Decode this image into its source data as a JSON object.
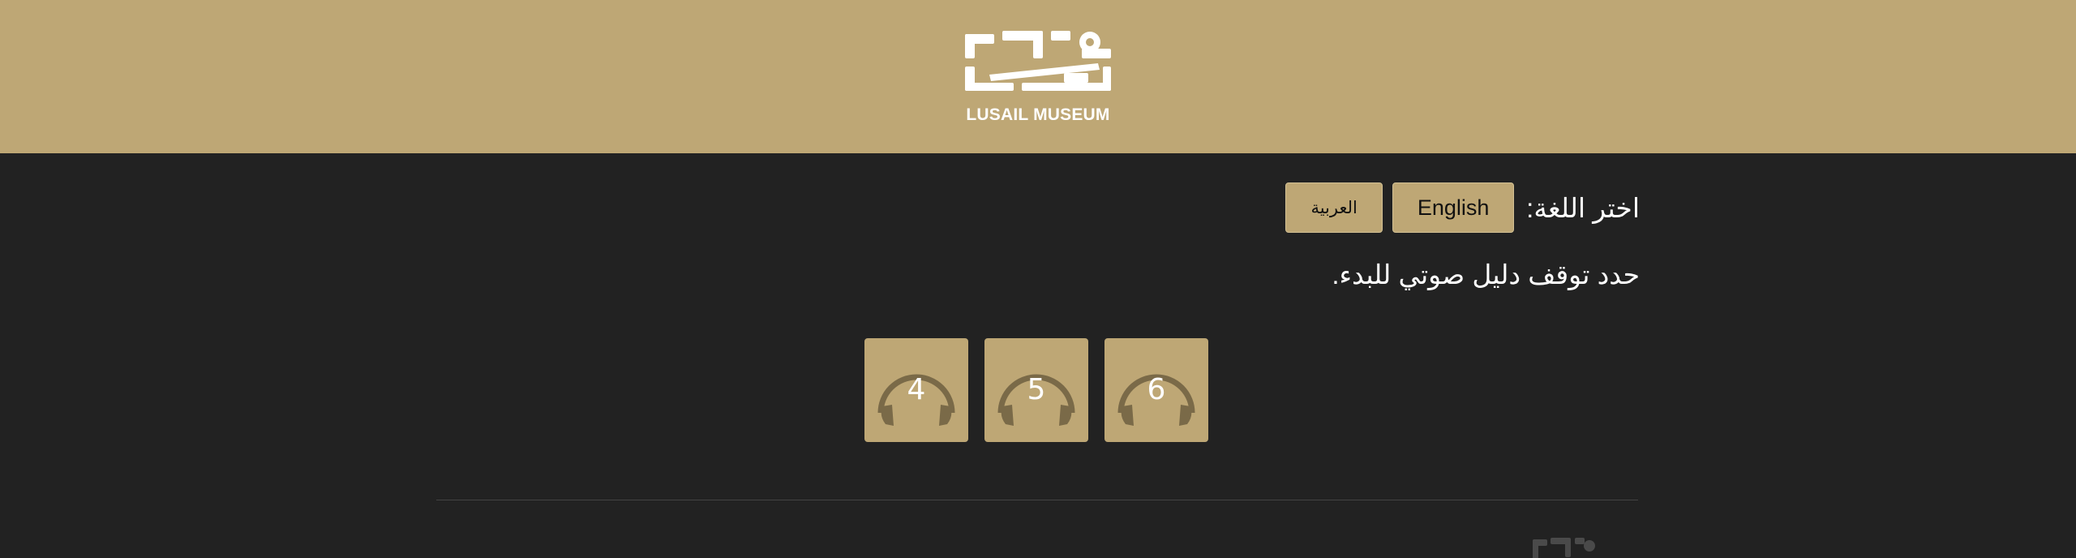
{
  "header": {
    "logo_text": "LUSAIL MUSEUM",
    "background_color": "#bea775"
  },
  "language": {
    "label": "اختر اللغة:",
    "options": [
      "English",
      "العربية"
    ]
  },
  "instruction": "حدد توقف دليل صوتي للبدء.",
  "stops": [
    {
      "number": "6",
      "icon": "headphones-icon"
    },
    {
      "number": "5",
      "icon": "headphones-icon"
    },
    {
      "number": "4",
      "icon": "headphones-icon"
    }
  ],
  "colors": {
    "accent": "#bea775",
    "background": "#222222",
    "icon": "#7a6a48"
  }
}
